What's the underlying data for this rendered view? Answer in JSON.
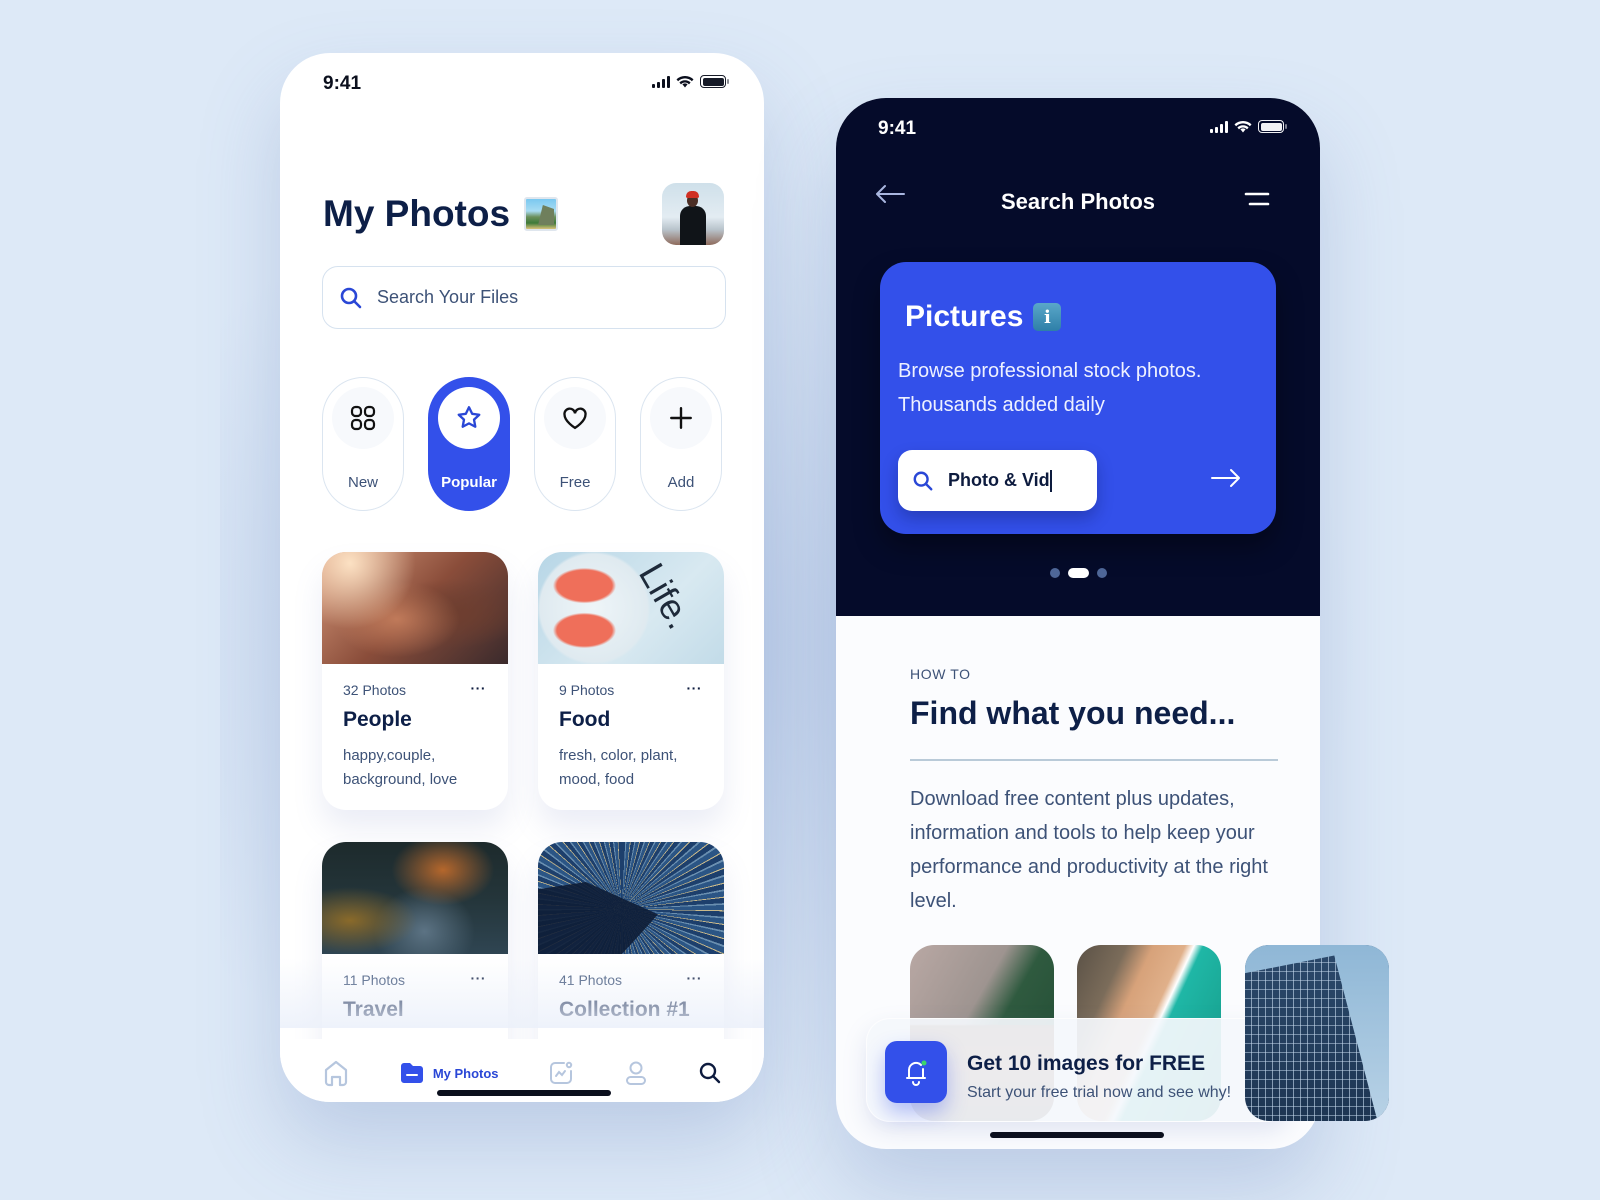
{
  "colors": {
    "accent": "#3350ea",
    "navy_text": "#0d1f47",
    "muted_text": "#3d5277",
    "dark_bg": "#050b2a",
    "background": "#dde9f7"
  },
  "phone1": {
    "status_time": "9:41",
    "title": "My Photos",
    "title_emoji": "framed-picture-emoji",
    "avatar": "user-avatar",
    "search": {
      "placeholder": "Search Your Files",
      "value": ""
    },
    "categories": [
      {
        "label": "New",
        "icon": "grid-icon",
        "active": false
      },
      {
        "label": "Popular",
        "icon": "star-icon",
        "active": true
      },
      {
        "label": "Free",
        "icon": "heart-icon",
        "active": false
      },
      {
        "label": "Add",
        "icon": "plus-icon",
        "active": false
      }
    ],
    "albums": [
      {
        "count": "32 Photos",
        "name": "People",
        "tags": "happy,couple, background, love",
        "more": "···"
      },
      {
        "count": "9 Photos",
        "name": "Food",
        "tags": "fresh, color, plant, mood, food",
        "more": "···"
      },
      {
        "count": "11 Photos",
        "name": "Travel",
        "tags": "",
        "more": "···"
      },
      {
        "count": "41 Photos",
        "name": "Collection #1",
        "tags": "",
        "more": "···"
      }
    ],
    "tabbar": [
      {
        "label": "",
        "icon": "home-icon",
        "active": false
      },
      {
        "label": "My Photos",
        "icon": "folder-icon",
        "active": true
      },
      {
        "label": "",
        "icon": "activity-icon",
        "active": false
      },
      {
        "label": "",
        "icon": "profile-icon",
        "active": false
      },
      {
        "label": "",
        "icon": "search-icon",
        "active": false
      }
    ]
  },
  "phone2": {
    "status_time": "9:41",
    "nav": {
      "title": "Search Photos",
      "back_icon": "arrow-left-icon",
      "menu_icon": "menu-icon"
    },
    "promo": {
      "title": "Pictures",
      "title_emoji": "info-emoji",
      "description": "Browse professional stock photos. Thousands added daily",
      "search_value": "Photo & Vid",
      "go_icon": "arrow-right-icon"
    },
    "pager": {
      "total": 3,
      "active_index": 1
    },
    "howto": {
      "eyebrow": "HOW TO",
      "heading": "Find what you need...",
      "paragraph": "Download free content plus updates, information and tools to help keep your performance and productivity at the right level."
    },
    "thumbnails": [
      "mountain-cabin",
      "aerial-beach",
      "glass-building"
    ],
    "toast": {
      "title": "Get 10 images for FREE",
      "subtitle": "Start your free trial now and see why!",
      "icon": "bell-icon"
    }
  }
}
